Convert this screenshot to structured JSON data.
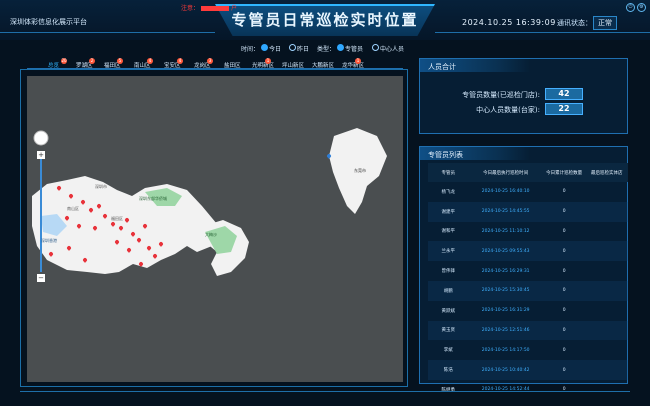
{
  "header": {
    "platform_name": "深圳体彩信息化展示平台",
    "title": "专管员日常巡检实时位置",
    "notice": "注意：",
    "notice_suffix": "户",
    "datetime": "2024.10.25 16:39:09",
    "comm_label": "通讯状态：",
    "comm_status": "正常"
  },
  "filters": {
    "time_label": "时间：",
    "time_options": [
      "今日",
      "昨日"
    ],
    "time_selected": "今日",
    "type_label": "类型：",
    "type_options": [
      "专管员",
      "中心人员"
    ],
    "type_selected": "专管员"
  },
  "districts": [
    {
      "label": "总览",
      "badge": "20"
    },
    {
      "label": "罗湖区",
      "badge": "2"
    },
    {
      "label": "福田区",
      "badge": "5"
    },
    {
      "label": "南山区",
      "badge": "4"
    },
    {
      "label": "宝安区",
      "badge": "4"
    },
    {
      "label": "龙岗区",
      "badge": "3"
    },
    {
      "label": "盐田区",
      "badge": ""
    },
    {
      "label": "光明新区",
      "badge": "1"
    },
    {
      "label": "坪山新区",
      "badge": ""
    },
    {
      "label": "大鹏新区",
      "badge": ""
    },
    {
      "label": "龙华新区",
      "badge": "1"
    }
  ],
  "personnel": {
    "title": "人员合计",
    "rows": [
      {
        "label": "专管员数量(已巡检门店):",
        "value": "42"
      },
      {
        "label": "中心人员数量(台家):",
        "value": "22"
      }
    ]
  },
  "staff": {
    "title": "专管员列表",
    "columns": [
      "专管员",
      "今日最后执行巡检时间",
      "今日累计巡检数量",
      "最后巡检实体店"
    ],
    "rows": [
      {
        "name": "杨飞龙",
        "time": "2024-10-25 16:40:10",
        "count": "0",
        "store": ""
      },
      {
        "name": "谢建平",
        "time": "2024-10-25 14:45:55",
        "count": "0",
        "store": ""
      },
      {
        "name": "谢和平",
        "time": "2024-10-25 11:10:12",
        "count": "0",
        "store": ""
      },
      {
        "name": "兰永平",
        "time": "2024-10-25 09:55:43",
        "count": "0",
        "store": ""
      },
      {
        "name": "曾伟锋",
        "time": "2024-10-25 16:29:31",
        "count": "0",
        "store": ""
      },
      {
        "name": "胡鹏",
        "time": "2024-10-25 15:30:45",
        "count": "0",
        "store": ""
      },
      {
        "name": "黄跃斌",
        "time": "2024-10-25 16:31:29",
        "count": "0",
        "store": ""
      },
      {
        "name": "黄玉贤",
        "time": "2024-10-25 12:51:46",
        "count": "0",
        "store": ""
      },
      {
        "name": "李斌",
        "time": "2024-10-25 14:17:50",
        "count": "0",
        "store": ""
      },
      {
        "name": "陈浩",
        "time": "2024-10-25 10:40:42",
        "count": "0",
        "store": ""
      },
      {
        "name": "陈继勇",
        "time": "2024-10-25 14:52:44",
        "count": "0",
        "store": ""
      }
    ]
  },
  "map": {
    "labels": [
      "深圳市",
      "东莞市",
      "深圳东部华侨城",
      "大梅沙",
      "深圳香港",
      "南山区",
      "福田区"
    ],
    "zoom_plus": "+",
    "zoom_minus": "−"
  },
  "colors": {
    "accent": "#2fb6ff",
    "pin": "#e8323a",
    "land": "#f2f2f2",
    "water": "#4a4e50"
  }
}
